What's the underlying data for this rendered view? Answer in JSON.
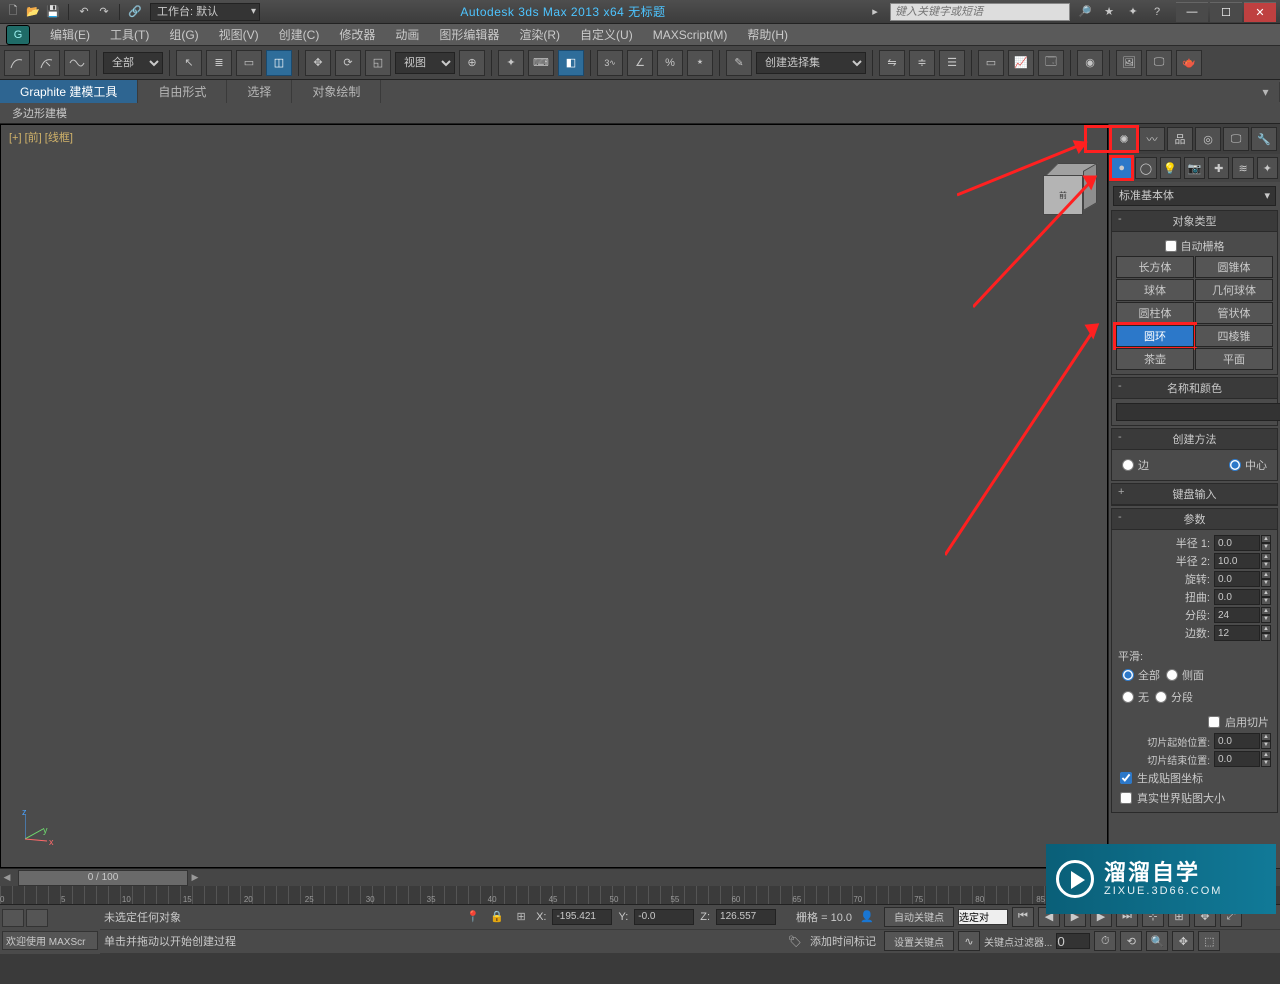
{
  "title": "Autodesk 3ds Max  2013 x64     无标题",
  "search_placeholder": "键入关键字或短语",
  "workspace_label": "工作台: 默认",
  "menubar": [
    "编辑(E)",
    "工具(T)",
    "组(G)",
    "视图(V)",
    "创建(C)",
    "修改器",
    "动画",
    "图形编辑器",
    "渲染(R)",
    "自定义(U)",
    "MAXScript(M)",
    "帮助(H)"
  ],
  "filter_dd": "全部",
  "view_dd": "视图",
  "named_sel": "创建选择集",
  "ribbon": {
    "tabs": [
      "Graphite 建模工具",
      "自由形式",
      "选择",
      "对象绘制"
    ],
    "sub": "多边形建模"
  },
  "viewport_label": "[+] [前] [线框]",
  "viewcube_face": "前",
  "cmd": {
    "dd": "标准基本体",
    "obj_type_title": "对象类型",
    "autogrid": "自动栅格",
    "objects": [
      "长方体",
      "圆锥体",
      "球体",
      "几何球体",
      "圆柱体",
      "管状体",
      "圆环",
      "四棱锥",
      "茶壶",
      "平面"
    ],
    "selected_obj_index": 6,
    "name_color_title": "名称和颜色",
    "create_method_title": "创建方法",
    "cm_edge": "边",
    "cm_center": "中心",
    "kb_input_title": "键盘输入",
    "params_title": "参数",
    "params": {
      "r1_label": "半径 1:",
      "r1": "0.0",
      "r2_label": "半径 2:",
      "r2": "10.0",
      "rot_label": "旋转:",
      "rot": "0.0",
      "twist_label": "扭曲:",
      "twist": "0.0",
      "seg_label": "分段:",
      "seg": "24",
      "sides_label": "边数:",
      "sides": "12"
    },
    "smooth_label": "平滑:",
    "smooth_opts": [
      "全部",
      "侧面",
      "无",
      "分段"
    ],
    "slice_on": "启用切片",
    "slice_from_label": "切片起始位置:",
    "slice_from": "0.0",
    "slice_to_label": "切片结束位置:",
    "slice_to": "0.0",
    "gen_map": "生成贴图坐标",
    "real_world": "真实世界贴图大小"
  },
  "slider_text": "0 / 100",
  "status": {
    "welcome": "欢迎使用  MAXScr",
    "no_sel": "未选定任何对象",
    "hint": "单击并拖动以开始创建过程",
    "x": "-195.421",
    "y": "-0.0",
    "z": "126.557",
    "grid": "栅格 = 10.0",
    "add_time_tag": "添加时间标记",
    "autokey": "自动关键点",
    "setkey": "设置关键点",
    "selset": "选定对",
    "keyfilter": "关键点过滤器..."
  },
  "watermark": {
    "big": "溜溜自学",
    "small": "ZIXUE.3D66.COM"
  }
}
